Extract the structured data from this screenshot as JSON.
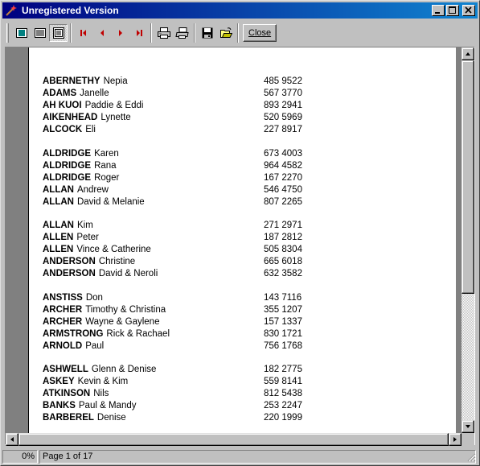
{
  "window": {
    "title": "Unregistered Version"
  },
  "toolbar": {
    "close_label": "Close",
    "icons": [
      "page-width-icon",
      "two-pages-icon",
      "whole-page-icon",
      "first-page-icon",
      "previous-page-icon",
      "next-page-icon",
      "last-page-icon",
      "print-setup-icon",
      "print-icon",
      "save-icon",
      "open-icon"
    ]
  },
  "entries": [
    {
      "surname": "ABERNETHY",
      "given": "Nepia",
      "phone": "485 9522"
    },
    {
      "surname": "ADAMS",
      "given": "Janelle",
      "phone": "567 3770"
    },
    {
      "surname": "AH KUOI",
      "given": "Paddie & Eddi",
      "phone": "893 2941"
    },
    {
      "surname": "AIKENHEAD",
      "given": "Lynette",
      "phone": "520 5969"
    },
    {
      "surname": "ALCOCK",
      "given": "Eli",
      "phone": "227 8917"
    },
    {
      "surname": "ALDRIDGE",
      "given": "Karen",
      "phone": "673 4003"
    },
    {
      "surname": "ALDRIDGE",
      "given": "Rana",
      "phone": "964 4582"
    },
    {
      "surname": "ALDRIDGE",
      "given": "Roger",
      "phone": "167 2270"
    },
    {
      "surname": "ALLAN",
      "given": "Andrew",
      "phone": "546 4750"
    },
    {
      "surname": "ALLAN",
      "given": "David & Melanie",
      "phone": "807 2265"
    },
    {
      "surname": "ALLAN",
      "given": "Kim",
      "phone": "271 2971"
    },
    {
      "surname": "ALLEN",
      "given": "Peter",
      "phone": "187 2812"
    },
    {
      "surname": "ALLEN",
      "given": "Vince & Catherine",
      "phone": "505 8304"
    },
    {
      "surname": "ANDERSON",
      "given": "Christine",
      "phone": "665 6018"
    },
    {
      "surname": "ANDERSON",
      "given": "David & Neroli",
      "phone": "632 3582"
    },
    {
      "surname": "ANSTISS",
      "given": "Don",
      "phone": "143 7116"
    },
    {
      "surname": "ARCHER",
      "given": "Timothy & Christina",
      "phone": "355 1207"
    },
    {
      "surname": "ARCHER",
      "given": "Wayne & Gaylene",
      "phone": "157 1337"
    },
    {
      "surname": "ARMSTRONG",
      "given": "Rick & Rachael",
      "phone": "830 1721"
    },
    {
      "surname": "ARNOLD",
      "given": "Paul",
      "phone": "756 1768"
    },
    {
      "surname": "ASHWELL",
      "given": "Glenn & Denise",
      "phone": "182 2775"
    },
    {
      "surname": "ASKEY",
      "given": "Kevin & Kim",
      "phone": "559 8141"
    },
    {
      "surname": "ATKINSON",
      "given": "Nils",
      "phone": "812 5438"
    },
    {
      "surname": "BANKS",
      "given": "Paul & Mandy",
      "phone": "253 2247"
    },
    {
      "surname": "BARBEREL",
      "given": "Denise",
      "phone": "220 1999"
    }
  ],
  "status": {
    "zoom": "0%",
    "page": "Page 1 of 17"
  },
  "colors": {
    "titlebar_start": "#000080",
    "titlebar_end": "#1084d0",
    "nav_arrow": "#c00000"
  }
}
